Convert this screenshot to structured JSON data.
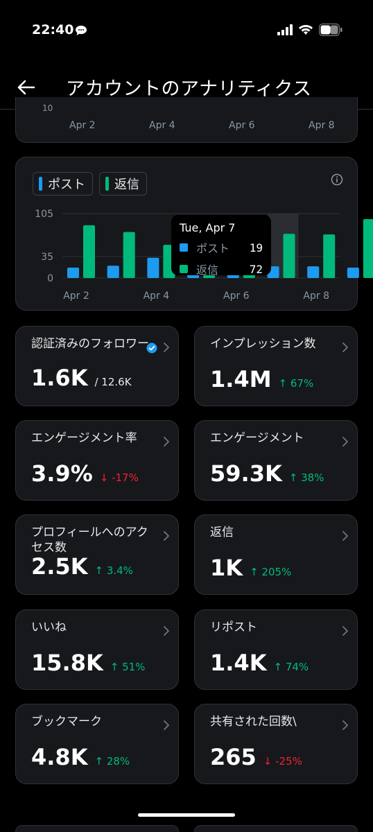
{
  "status_bar": {
    "time": "22:40"
  },
  "header": {
    "title": "アカウントのアナリティクス"
  },
  "prev_chart": {
    "y_tick": "10",
    "x_ticks": [
      "Apr 2",
      "Apr 4",
      "Apr 6",
      "Apr 8"
    ]
  },
  "chart_data": {
    "type": "bar",
    "categories": [
      "Apr 2",
      "Apr 3",
      "Apr 4",
      "Apr 5",
      "Apr 6",
      "Apr 7",
      "Apr 8",
      "Apr 9"
    ],
    "x_ticks": [
      "Apr 2",
      "Apr 4",
      "Apr 6",
      "Apr 8"
    ],
    "y_ticks": [
      "105",
      "35",
      "0"
    ],
    "ylim": [
      0,
      105
    ],
    "series": [
      {
        "name": "ポスト",
        "color": "#1d9bf0",
        "values": [
          17,
          20,
          33,
          14,
          14,
          19,
          19,
          17
        ]
      },
      {
        "name": "返信",
        "color": "#00ba7c",
        "values": [
          86,
          75,
          54,
          40,
          40,
          72,
          71,
          96
        ]
      }
    ],
    "highlight_index": 5,
    "tooltip": {
      "date": "Tue, Apr 7",
      "rows": [
        {
          "name": "ポスト",
          "value": "19"
        },
        {
          "name": "返信",
          "value": "72"
        }
      ]
    }
  },
  "stats": [
    {
      "label": "認証済みのフォロワー",
      "value": "1.6K",
      "sub": "/ 12.6K",
      "change": "",
      "direction": "",
      "verified": true
    },
    {
      "label": "インプレッション数",
      "value": "1.4M",
      "sub": "",
      "change": "↑ 67%",
      "direction": "up"
    },
    {
      "label": "エンゲージメント率",
      "value": "3.9%",
      "sub": "",
      "change": "↓ -17%",
      "direction": "down"
    },
    {
      "label": "エンゲージメント",
      "value": "59.3K",
      "sub": "",
      "change": "↑ 38%",
      "direction": "up"
    },
    {
      "label": "プロフィールへのアクセス数",
      "value": "2.5K",
      "sub": "",
      "change": "↑ 3.4%",
      "direction": "up"
    },
    {
      "label": "返信",
      "value": "1K",
      "sub": "",
      "change": "↑ 205%",
      "direction": "up"
    },
    {
      "label": "いいね",
      "value": "15.8K",
      "sub": "",
      "change": "↑ 51%",
      "direction": "up"
    },
    {
      "label": "リポスト",
      "value": "1.4K",
      "sub": "",
      "change": "↑ 74%",
      "direction": "up"
    },
    {
      "label": "ブックマーク",
      "value": "4.8K",
      "sub": "",
      "change": "↑ 28%",
      "direction": "up"
    },
    {
      "label": "共有された回数\\",
      "value": "265",
      "sub": "",
      "change": "↓ -25%",
      "direction": "down"
    }
  ]
}
